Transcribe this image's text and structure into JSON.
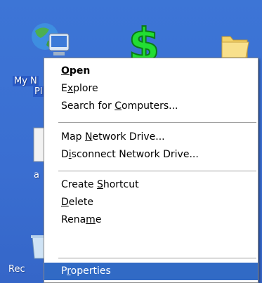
{
  "desktop": {
    "icons": {
      "my_network_label_line1": "My N",
      "my_network_label_line2": "Pl",
      "partial_label_a": "a",
      "recycle_label": "Rec"
    }
  },
  "context_menu": {
    "items": [
      {
        "label_parts": [
          "",
          "O",
          "pen"
        ]
      },
      {
        "label_parts": [
          "E",
          "x",
          "plore"
        ]
      },
      {
        "label_parts": [
          "Search for ",
          "C",
          "omputers..."
        ]
      },
      {
        "label_parts": [
          "Map ",
          "N",
          "etwork Drive..."
        ]
      },
      {
        "label_parts": [
          "D",
          "i",
          "sconnect Network Drive..."
        ]
      },
      {
        "label_parts": [
          "Create ",
          "S",
          "hortcut"
        ]
      },
      {
        "label_parts": [
          "",
          "D",
          "elete"
        ]
      },
      {
        "label_parts": [
          "Rena",
          "m",
          "e"
        ]
      },
      {
        "label_parts": [
          "P",
          "r",
          "operties"
        ]
      }
    ],
    "selected_item": "Properties",
    "highlight_color": "#316ac5"
  }
}
